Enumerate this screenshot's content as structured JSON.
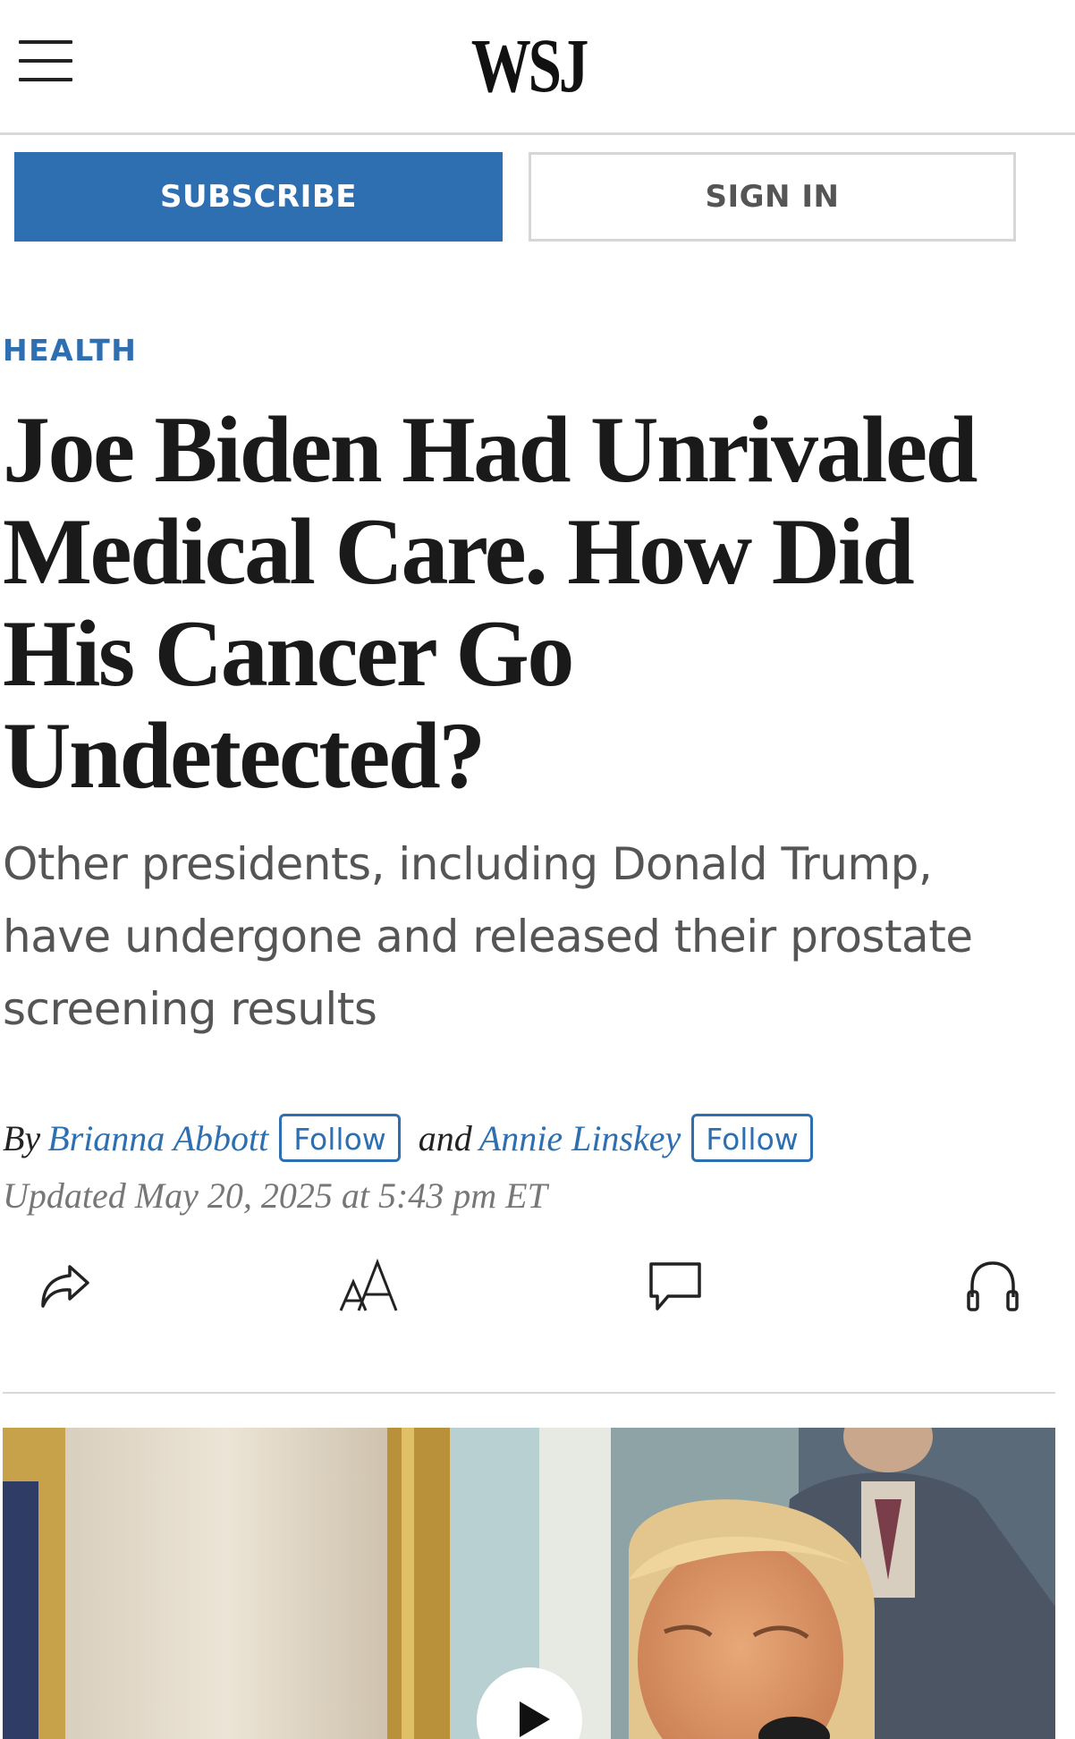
{
  "header": {
    "logo": "WSJ",
    "menu_icon": "hamburger-menu-icon"
  },
  "account": {
    "subscribe_label": "SUBSCRIBE",
    "signin_label": "SIGN IN"
  },
  "article": {
    "section": "HEALTH",
    "headline": "Joe Biden Had Unrivaled Medical Care. How Did His Cancer Go Undetected?",
    "dek": "Other presidents, including Donald Trump, have undergone and released their prostate screening results",
    "byline": {
      "by": "By",
      "authors": [
        {
          "name": "Brianna Abbott",
          "follow_label": "Follow"
        },
        {
          "name": "Annie Linskey",
          "follow_label": "Follow"
        }
      ],
      "conjunction": "and"
    },
    "timestamp": "Updated May 20, 2025 at 5:43 pm ET"
  },
  "tools": [
    {
      "name": "share",
      "icon": "share-arrow-icon"
    },
    {
      "name": "text-size",
      "icon": "text-size-icon"
    },
    {
      "name": "comments",
      "icon": "comment-bubble-icon"
    },
    {
      "name": "listen",
      "icon": "headphones-icon"
    }
  ],
  "hero_media": {
    "type": "video",
    "play_icon": "play-icon"
  },
  "colors": {
    "accent": "#2d6fb0",
    "headline": "#1a1a1a",
    "dek": "#555555",
    "timestamp": "#777777",
    "divider": "#d9d9d9"
  }
}
